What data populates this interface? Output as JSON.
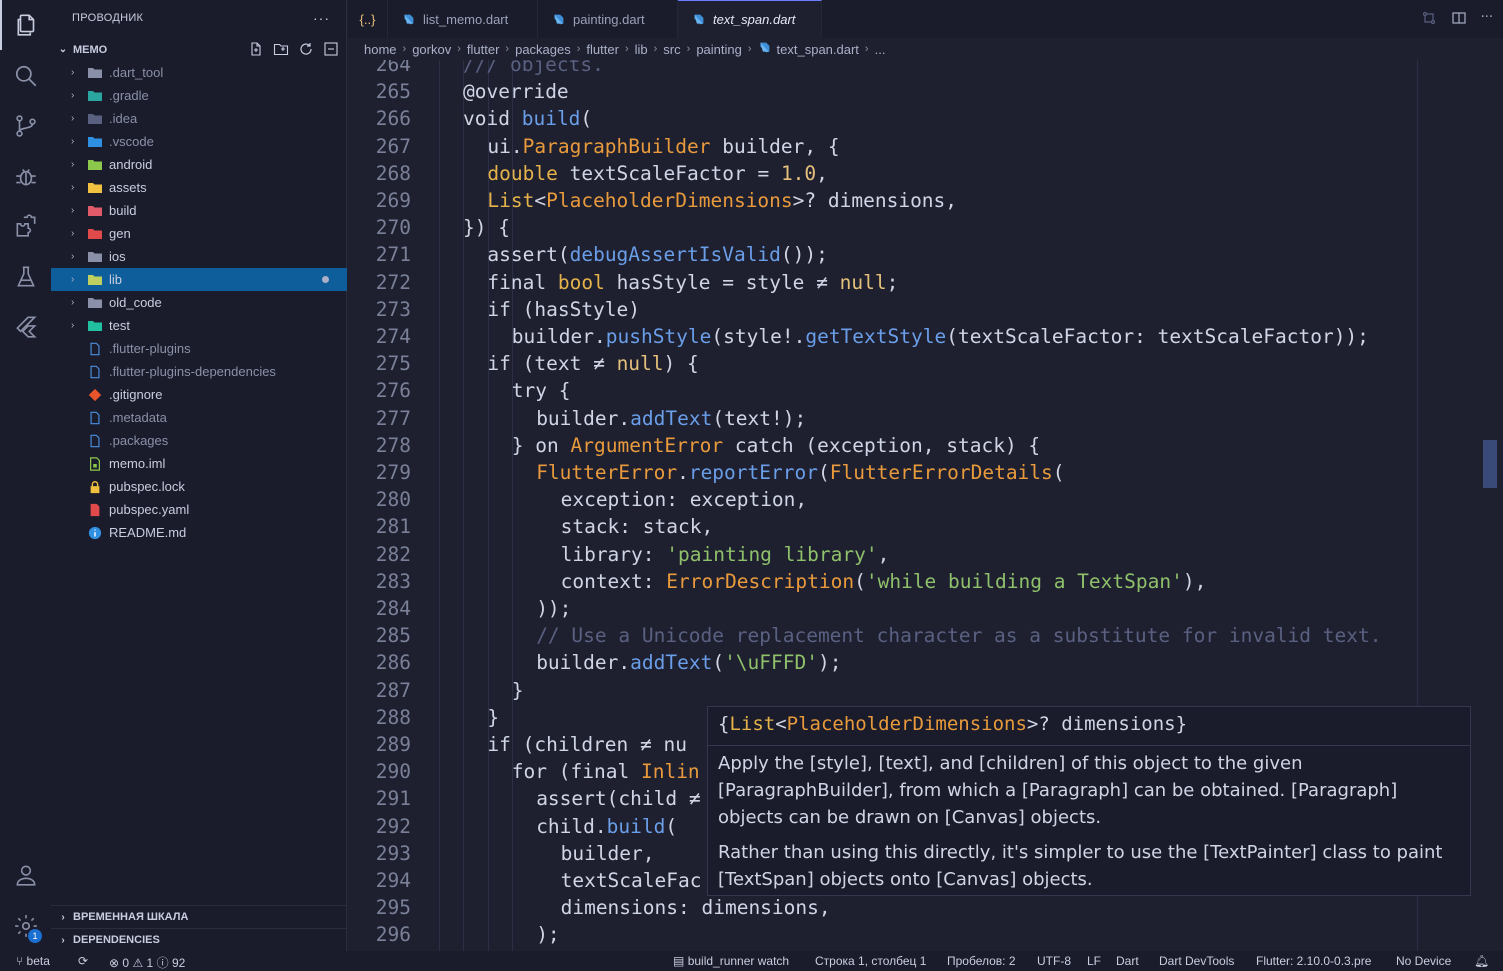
{
  "activity_bar": {
    "items": [
      "explorer-icon",
      "search-icon",
      "source-control-icon",
      "debug-icon",
      "extensions-icon",
      "testing-icon",
      "flutter-icon"
    ],
    "bottom": [
      "account-icon",
      "settings-icon"
    ],
    "settings_badge": "1"
  },
  "sidebar": {
    "title": "ПРОВОДНИК",
    "more": "···",
    "section_title": "MEMO",
    "items": [
      {
        "name": ".dart_tool",
        "type": "folder",
        "color": "#8a90a8"
      },
      {
        "name": ".gradle",
        "type": "folder",
        "color": "#2aa5a0"
      },
      {
        "name": ".idea",
        "type": "folder",
        "color": "#5a6080"
      },
      {
        "name": ".vscode",
        "type": "folder",
        "color": "#2f8fe0"
      },
      {
        "name": "android",
        "type": "folder",
        "color": "#8cc84b"
      },
      {
        "name": "assets",
        "type": "folder",
        "color": "#f0c040"
      },
      {
        "name": "build",
        "type": "folder",
        "color": "#e05a6a"
      },
      {
        "name": "gen",
        "type": "folder",
        "color": "#e04a4a"
      },
      {
        "name": "ios",
        "type": "folder",
        "color": "#8a90a8"
      },
      {
        "name": "lib",
        "type": "folder",
        "color": "#c0d060"
      },
      {
        "name": "old_code",
        "type": "folder",
        "color": "#8a90a8"
      },
      {
        "name": "test",
        "type": "folder",
        "color": "#20c0a0"
      },
      {
        "name": ".flutter-plugins",
        "type": "file",
        "color": "#4a90e2"
      },
      {
        "name": ".flutter-plugins-dependencies",
        "type": "file",
        "color": "#4a90e2"
      },
      {
        "name": ".gitignore",
        "type": "git",
        "color": "#e8552c"
      },
      {
        "name": ".metadata",
        "type": "file",
        "color": "#4a90e2"
      },
      {
        "name": ".packages",
        "type": "file",
        "color": "#4a90e2"
      },
      {
        "name": "memo.iml",
        "type": "iml",
        "color": "#8cc84b"
      },
      {
        "name": "pubspec.lock",
        "type": "lock",
        "color": "#f0c040"
      },
      {
        "name": "pubspec.yaml",
        "type": "yaml",
        "color": "#e04a4a"
      },
      {
        "name": "README.md",
        "type": "info",
        "color": "#2f8fe0"
      }
    ],
    "timeline_title": "ВРЕМЕННАЯ ШКАЛА",
    "dependencies_title": "DEPENDENCIES"
  },
  "tabs": [
    {
      "label": "{..}",
      "kind": "json"
    },
    {
      "label": "list_memo.dart",
      "kind": "dart"
    },
    {
      "label": "painting.dart",
      "kind": "dart"
    },
    {
      "label": "text_span.dart",
      "kind": "dart",
      "active": true
    }
  ],
  "breadcrumb": [
    "home",
    "gorkov",
    "flutter",
    "packages",
    "flutter",
    "lib",
    "src",
    "painting",
    "text_span.dart",
    "..."
  ],
  "code": {
    "lines": [
      {
        "n": "264",
        "t": "/// objects."
      },
      {
        "n": "265",
        "t": "@override"
      },
      {
        "n": "266",
        "t": "void build("
      },
      {
        "n": "267",
        "t": "ui.ParagraphBuilder builder, {"
      },
      {
        "n": "268",
        "t": "double textScaleFactor = 1.0,"
      },
      {
        "n": "269",
        "t": "List<PlaceholderDimensions>? dimensions,"
      },
      {
        "n": "270",
        "t": "}) {"
      },
      {
        "n": "271",
        "t": "assert(debugAssertIsValid());"
      },
      {
        "n": "272",
        "t": "final bool hasStyle = style ≠ null;"
      },
      {
        "n": "273",
        "t": "if (hasStyle)"
      },
      {
        "n": "274",
        "t": "builder.pushStyle(style!.getTextStyle(textScaleFactor: textScaleFactor));"
      },
      {
        "n": "275",
        "t": "if (text ≠ null) {"
      },
      {
        "n": "276",
        "t": "try {"
      },
      {
        "n": "277",
        "t": "builder.addText(text!);"
      },
      {
        "n": "278",
        "t": "} on ArgumentError catch (exception, stack) {"
      },
      {
        "n": "279",
        "t": "FlutterError.reportError(FlutterErrorDetails("
      },
      {
        "n": "280",
        "t": "exception: exception,"
      },
      {
        "n": "281",
        "t": "stack: stack,"
      },
      {
        "n": "282",
        "t": "library: 'painting library',"
      },
      {
        "n": "283",
        "t": "context: ErrorDescription('while building a TextSpan'),"
      },
      {
        "n": "284",
        "t": "));"
      },
      {
        "n": "285",
        "t": "// Use a Unicode replacement character as a substitute for invalid text."
      },
      {
        "n": "286",
        "t": "builder.addText('\\uFFFD');"
      },
      {
        "n": "287",
        "t": "}"
      },
      {
        "n": "288",
        "t": "}"
      },
      {
        "n": "289",
        "t": "if (children ≠ nu"
      },
      {
        "n": "290",
        "t": "for (final Inlin"
      },
      {
        "n": "291",
        "t": "assert(child ≠"
      },
      {
        "n": "292",
        "t": "child.build("
      },
      {
        "n": "293",
        "t": "builder,"
      },
      {
        "n": "294",
        "t": "textScaleFac"
      },
      {
        "n": "295",
        "t": "dimensions: dimensions,"
      },
      {
        "n": "296",
        "t": ");"
      }
    ]
  },
  "hover": {
    "signature": "{List<PlaceholderDimensions>? dimensions}",
    "paragraph1": "Apply the [style], [text], and [children] of this object to the given [ParagraphBuilder], from which a [Paragraph] can be obtained. [Paragraph] objects can be drawn on [Canvas] objects.",
    "paragraph2": "Rather than using this directly, it's simpler to use the [TextPainter] class to paint [TextSpan] objects onto [Canvas] objects."
  },
  "statusbar": {
    "branch": "beta",
    "errors": "0",
    "warnings": "1",
    "infos": "92",
    "task": "build_runner watch",
    "position": "Строка 1, столбец 1",
    "spaces": "Пробелов: 2",
    "encoding": "UTF-8",
    "eol": "LF",
    "language": "Dart",
    "devtools": "Dart DevTools",
    "flutter": "Flutter: 2.10.0-0.3.pre",
    "device": "No Device"
  },
  "colors": {
    "background": "#1e2030",
    "sidebar": "#1a1c2b",
    "selection": "#0f5e9c",
    "keyword": "#d0d5e6",
    "type": "#e5b34a",
    "function": "#6a9ee8",
    "string": "#8fc06a",
    "comment": "#5a6080"
  }
}
